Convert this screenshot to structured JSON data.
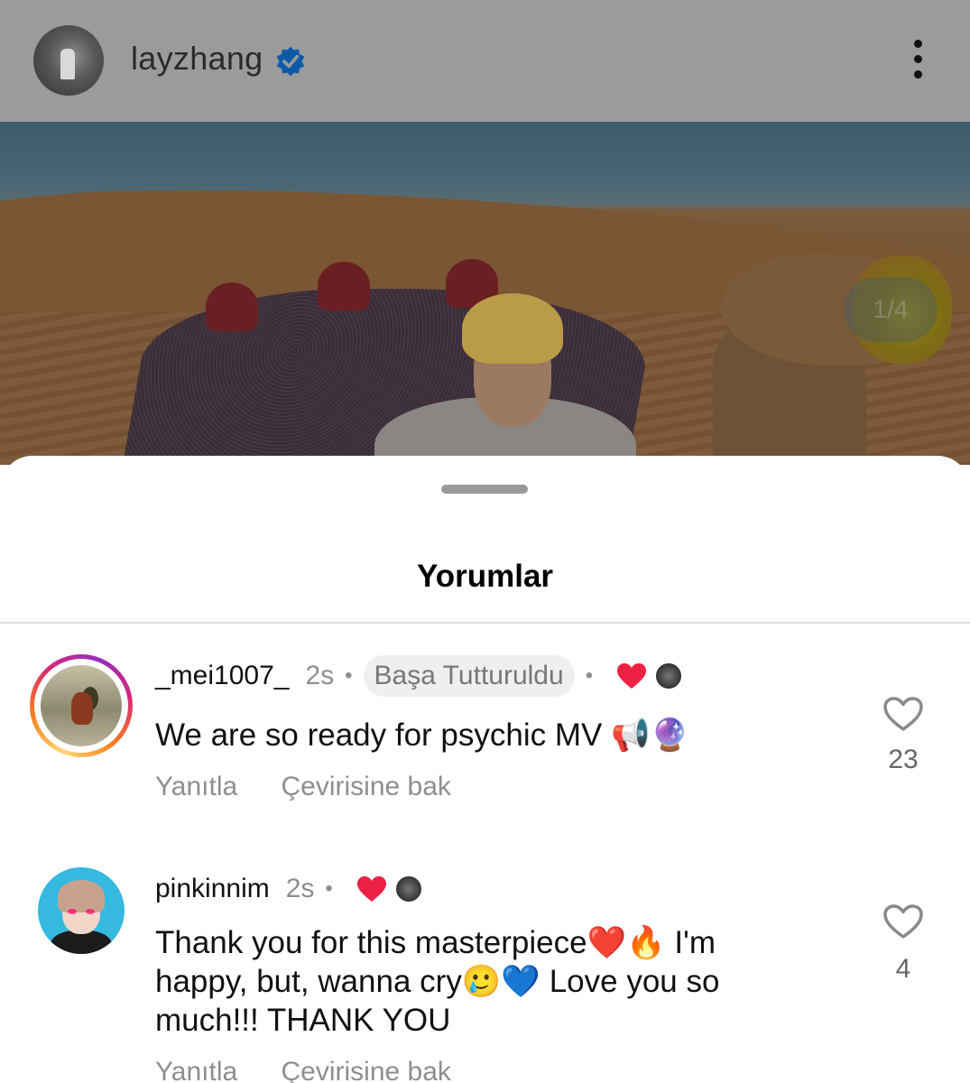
{
  "header": {
    "username": "layzhang",
    "avatar": "avatar-layzhang",
    "verified_icon": "verified-badge-icon",
    "menu_icon": "more-vertical-icon"
  },
  "post": {
    "carousel_counter": "1/4"
  },
  "sheet": {
    "title": "Yorumlar"
  },
  "comments": [
    {
      "username": "_mei1007_",
      "time": "2s",
      "pinned_label": "Başa Tutturuldu",
      "text": "We are so ready for psychic MV 📢🔮",
      "reply_label": "Yanıtla",
      "translate_label": "Çevirisine bak",
      "likes": "23",
      "liked_by_author": true
    },
    {
      "username": "pinkinnim",
      "time": "2s",
      "text": "Thank you for this masterpiece❤️🔥 I'm happy,  but,  wanna cry🥲💙 Love you so much!!! THANK YOU",
      "reply_label": "Yanıtla",
      "translate_label": "Çevirisine bak",
      "likes": "4",
      "liked_by_author": true
    }
  ],
  "colors": {
    "heart_red": "#ed2143",
    "verified_blue": "#0e5aa7",
    "secondary_text": "#8e8e8e"
  }
}
